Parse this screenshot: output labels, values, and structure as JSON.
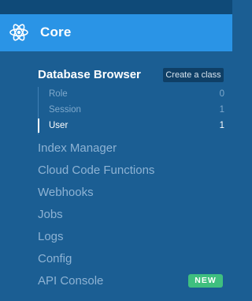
{
  "header": {
    "title": "Core",
    "icon": "atom-icon",
    "background": "#2a94e6"
  },
  "database_browser": {
    "title": "Database Browser",
    "create_button_label": "Create a class",
    "classes": [
      {
        "name": "Role",
        "count": "0",
        "active": false
      },
      {
        "name": "Session",
        "count": "1",
        "active": false
      },
      {
        "name": "User",
        "count": "1",
        "active": true
      }
    ]
  },
  "nav": {
    "items": [
      {
        "label": "Index Manager"
      },
      {
        "label": "Cloud Code Functions"
      },
      {
        "label": "Webhooks"
      },
      {
        "label": "Jobs"
      },
      {
        "label": "Logs"
      },
      {
        "label": "Config"
      },
      {
        "label": "API Console",
        "badge": "NEW"
      }
    ]
  },
  "colors": {
    "sidebar_bg": "#1b5e93",
    "badge_green": "#3fbf7f"
  }
}
